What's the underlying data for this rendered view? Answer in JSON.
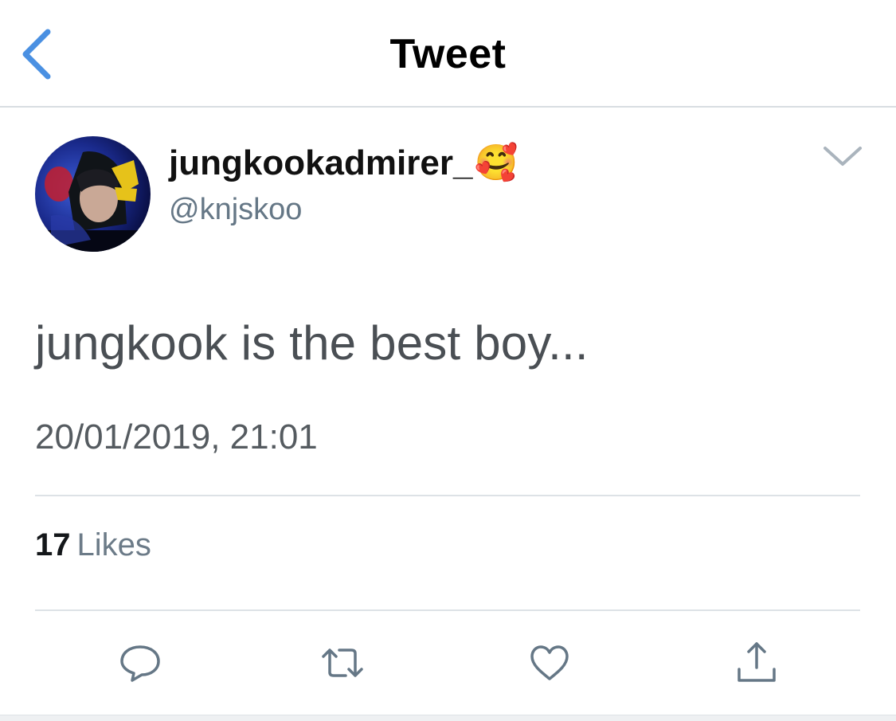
{
  "nav": {
    "title": "Tweet",
    "back_icon": "chevron-left-icon",
    "accent": "#4a90e2"
  },
  "tweet": {
    "display_name": "jungkookadmirer_",
    "display_emoji": "🥰",
    "handle": "@knjskoo",
    "text": "jungkook is the best boy...",
    "timestamp": "20/01/2019, 21:01",
    "likes_count": "17",
    "likes_label": "Likes"
  },
  "actions": [
    {
      "name": "reply",
      "icon": "speech-bubble-icon"
    },
    {
      "name": "retweet",
      "icon": "retweet-icon"
    },
    {
      "name": "like",
      "icon": "heart-icon"
    },
    {
      "name": "share",
      "icon": "share-icon"
    }
  ],
  "colors": {
    "icon_gray": "#657786",
    "text_dark": "#14171a",
    "divider": "#dde2e6"
  }
}
